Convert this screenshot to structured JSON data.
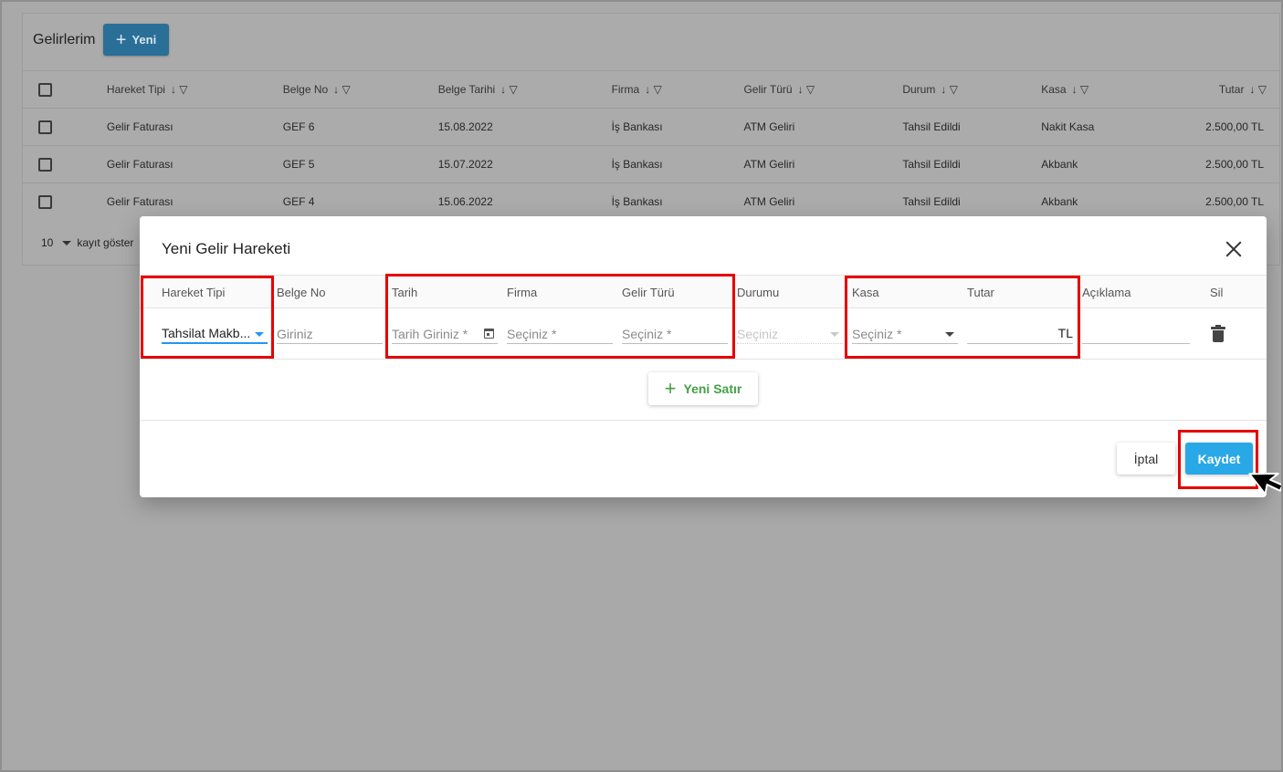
{
  "background": {
    "title": "Gelirlerim",
    "new_button": "Yeni",
    "columns": [
      "Hareket Tipi",
      "Belge No",
      "Belge Tarihi",
      "Firma",
      "Gelir Türü",
      "Durum",
      "Kasa",
      "Tutar"
    ],
    "rows": [
      [
        "Gelir Faturası",
        "GEF 6",
        "15.08.2022",
        "İş Bankası",
        "ATM Geliri",
        "Tahsil Edildi",
        "Nakit Kasa",
        "2.500,00 TL"
      ],
      [
        "Gelir Faturası",
        "GEF 5",
        "15.07.2022",
        "İş Bankası",
        "ATM Geliri",
        "Tahsil Edildi",
        "Akbank",
        "2.500,00 TL"
      ],
      [
        "Gelir Faturası",
        "GEF 4",
        "15.06.2022",
        "İş Bankası",
        "ATM Geliri",
        "Tahsil Edildi",
        "Akbank",
        "2.500,00 TL"
      ]
    ],
    "pager": {
      "page_size": "10",
      "label": "kayıt göster"
    }
  },
  "modal": {
    "title": "Yeni Gelir Hareketi",
    "headers": {
      "hareket_tipi": "Hareket Tipi",
      "belge_no": "Belge No",
      "tarih": "Tarih",
      "firma": "Firma",
      "gelir_turu": "Gelir Türü",
      "durumu": "Durumu",
      "kasa": "Kasa",
      "tutar": "Tutar",
      "aciklama": "Açıklama",
      "sil": "Sil"
    },
    "row": {
      "hareket_tipi_value": "Tahsilat Makb...",
      "belge_no_placeholder": "Giriniz",
      "tarih_placeholder": "Tarih Giriniz *",
      "firma_placeholder": "Seçiniz *",
      "gelir_turu_placeholder": "Seçiniz *",
      "durumu_placeholder": "Seçiniz",
      "kasa_placeholder": "Seçiniz *",
      "tutar_suffix": "TL"
    },
    "add_row_button": "Yeni Satır",
    "cancel_button": "İptal",
    "save_button": "Kaydet"
  },
  "icons": [
    "plus-icon",
    "sort-down-icon",
    "filter-icon",
    "close-icon",
    "calendar-icon",
    "chevron-down-icon",
    "trash-icon",
    "mouse-cursor-icon"
  ],
  "colors": {
    "primary": "#29a8e8",
    "add_row": "#43a047",
    "highlight": "#e60000",
    "focus": "#2196f3"
  }
}
